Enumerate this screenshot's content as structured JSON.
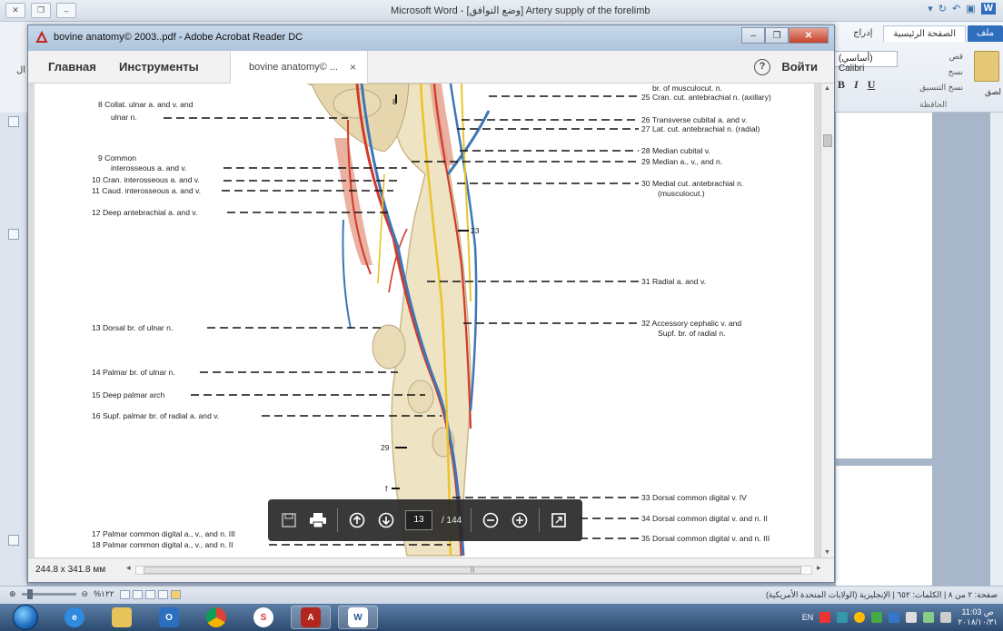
{
  "word": {
    "title": "Microsoft Word - [وضع التوافق] Artery supply of the forelimb",
    "tabs": [
      "ملف",
      "الصفحة الرئيسية",
      "إدراج"
    ],
    "font_name": "(أساسي) Calibri",
    "clipboard_items": [
      "قص",
      "نسخ",
      "نسخ التنسيق"
    ],
    "paste_label": "لصق",
    "clipboard_group": "الحافظة",
    "left_label": "ال",
    "status_right": "صفحة: ٢ من ٨  |  الكلمات: ٦٥٢  |  الإنجليزية (الولايات المتحدة الأمريكية)",
    "zoom": "%١٢٢"
  },
  "acrobat": {
    "title": "bovine anatomy© 2003..pdf - Adobe Acrobat Reader DC",
    "menu_home": "Главная",
    "menu_tools": "Инструменты",
    "doc_tab_label": "bovine anatomy© ...",
    "close_tab": "×",
    "help": "?",
    "login": "Войти",
    "page_size": "244.8 x 341.8 мм",
    "current_page": "13",
    "total_pages": "/ 144"
  },
  "figure": {
    "left_labels": [
      "8  Collat. ulnar a. and v. and",
      "ulnar n.",
      "9  Common",
      "interosseous a. and v.",
      "10  Cran. interosseous a. and v.",
      "11  Caud. interosseous a. and v.",
      "12  Deep antebrachial a. and v.",
      "13  Dorsal br. of ulnar n.",
      "14  Palmar br. of ulnar n.",
      "15  Deep palmar arch",
      "16  Supf. palmar br. of radial a. and v.",
      "17  Palmar common digital a., v., and n. III",
      "18  Palmar common digital a., v., and n. II"
    ],
    "right_labels": [
      "br. of musculocut. n.",
      "25  Cran. cut. antebrachial n. (axillary)",
      "26  Transverse cubital a. and v.",
      "27  Lat. cut. antebrachial n. (radial)",
      "28  Median cubital v.",
      "29  Median a., v., and n.",
      "30  Medial cut. antebrachial n.",
      "(musculocut.)",
      "31  Radial a. and v.",
      "32  Accessory cephalic v. and",
      "Supf. br. of radial n.",
      "33  Dorsal common digital v. IV",
      "34  Dorsal common digital v. and n. II",
      "35  Dorsal common digital v. and n. III"
    ],
    "inner_labels": [
      "8",
      "23",
      "29",
      "f"
    ]
  },
  "taskbar": {
    "tray_lang": "EN",
    "time": "11:03 ص",
    "date": "٢٠١٨/١٠/٣١"
  }
}
